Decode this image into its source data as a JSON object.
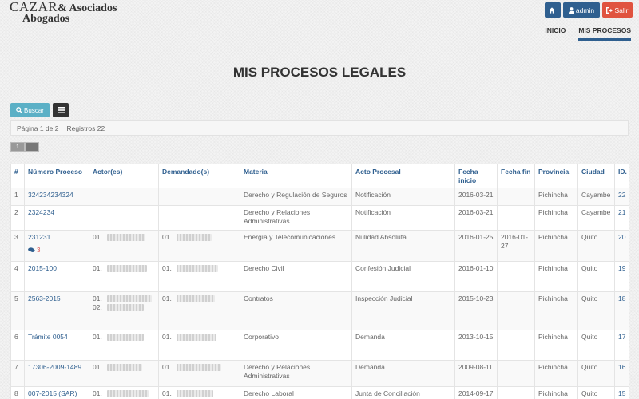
{
  "brand": {
    "line1_main": "CAZAR",
    "line1_small": "& Asociados",
    "line2": "Abogados"
  },
  "top_buttons": {
    "admin": "admin",
    "salir": "Salir"
  },
  "nav": {
    "inicio": "INICIO",
    "mis_procesos": "MIS PROCESOS"
  },
  "title": "MIS PROCESOS LEGALES",
  "toolbar": {
    "buscar": "Buscar"
  },
  "info": {
    "pagina": "Página 1 de 2",
    "registros": "Registros 22"
  },
  "pager": {
    "current": "1"
  },
  "table": {
    "headers": [
      "#",
      "Número Proceso",
      "Actor(es)",
      "Demandado(s)",
      "Materia",
      "Acto Procesal",
      "Fecha inicio",
      "Fecha fin",
      "Provincia",
      "Ciudad",
      "ID."
    ],
    "rows": [
      {
        "n": "1",
        "num": "324234234324",
        "actors": [],
        "demandados": [],
        "materia": "Derecho y Regulación de Seguros",
        "acto": "Notificación",
        "inicio": "2016-03-21",
        "fin": "",
        "provincia": "Pichincha",
        "ciudad": "Cayambe",
        "id": "22",
        "comments": ""
      },
      {
        "n": "2",
        "num": "2324234",
        "actors": [],
        "demandados": [],
        "materia": "Derecho y Relaciones Administrativas",
        "acto": "Notificación",
        "inicio": "2016-03-21",
        "fin": "",
        "provincia": "Pichincha",
        "ciudad": "Cayambe",
        "id": "21",
        "comments": ""
      },
      {
        "n": "3",
        "num": "231231",
        "actors": [
          "01."
        ],
        "demandados": [
          "01."
        ],
        "materia": "Energía y Telecomunicaciones",
        "acto": "Nulidad Absoluta",
        "inicio": "2016-01-25",
        "fin": "2016-01-27",
        "provincia": "Pichincha",
        "ciudad": "Quito",
        "id": "20",
        "comments": "3"
      },
      {
        "n": "4",
        "num": "2015-100",
        "actors": [
          "01."
        ],
        "demandados": [
          "01."
        ],
        "materia": "Derecho Civil",
        "acto": "Confesión Judicial",
        "inicio": "2016-01-10",
        "fin": "",
        "provincia": "Pichincha",
        "ciudad": "Quito",
        "id": "19",
        "comments": ""
      },
      {
        "n": "5",
        "num": "2563-2015",
        "actors": [
          "01.",
          "02."
        ],
        "demandados": [
          "01."
        ],
        "materia": "Contratos",
        "acto": "Inspección Judicial",
        "inicio": "2015-10-23",
        "fin": "",
        "provincia": "Pichincha",
        "ciudad": "Quito",
        "id": "18",
        "comments": ""
      },
      {
        "n": "6",
        "num": "Trámite 0054",
        "actors": [
          "01."
        ],
        "demandados": [
          "01."
        ],
        "materia": "Corporativo",
        "acto": "Demanda",
        "inicio": "2013-10-15",
        "fin": "",
        "provincia": "Pichincha",
        "ciudad": "Quito",
        "id": "17",
        "comments": ""
      },
      {
        "n": "7",
        "num": "17306-2009-1489",
        "actors": [
          "01."
        ],
        "demandados": [
          "01."
        ],
        "materia": "Derecho y Relaciones Administrativas",
        "acto": "Demanda",
        "inicio": "2009-08-11",
        "fin": "",
        "provincia": "Pichincha",
        "ciudad": "Quito",
        "id": "16",
        "comments": ""
      },
      {
        "n": "8",
        "num": "007-2015 (SAR)",
        "actors": [
          "01."
        ],
        "demandados": [
          "01."
        ],
        "materia": "Derecho Laboral",
        "acto": "Junta de Conciliación",
        "inicio": "2014-09-17",
        "fin": "",
        "provincia": "Pichincha",
        "ciudad": "Quito",
        "id": "15",
        "comments": ""
      }
    ]
  }
}
